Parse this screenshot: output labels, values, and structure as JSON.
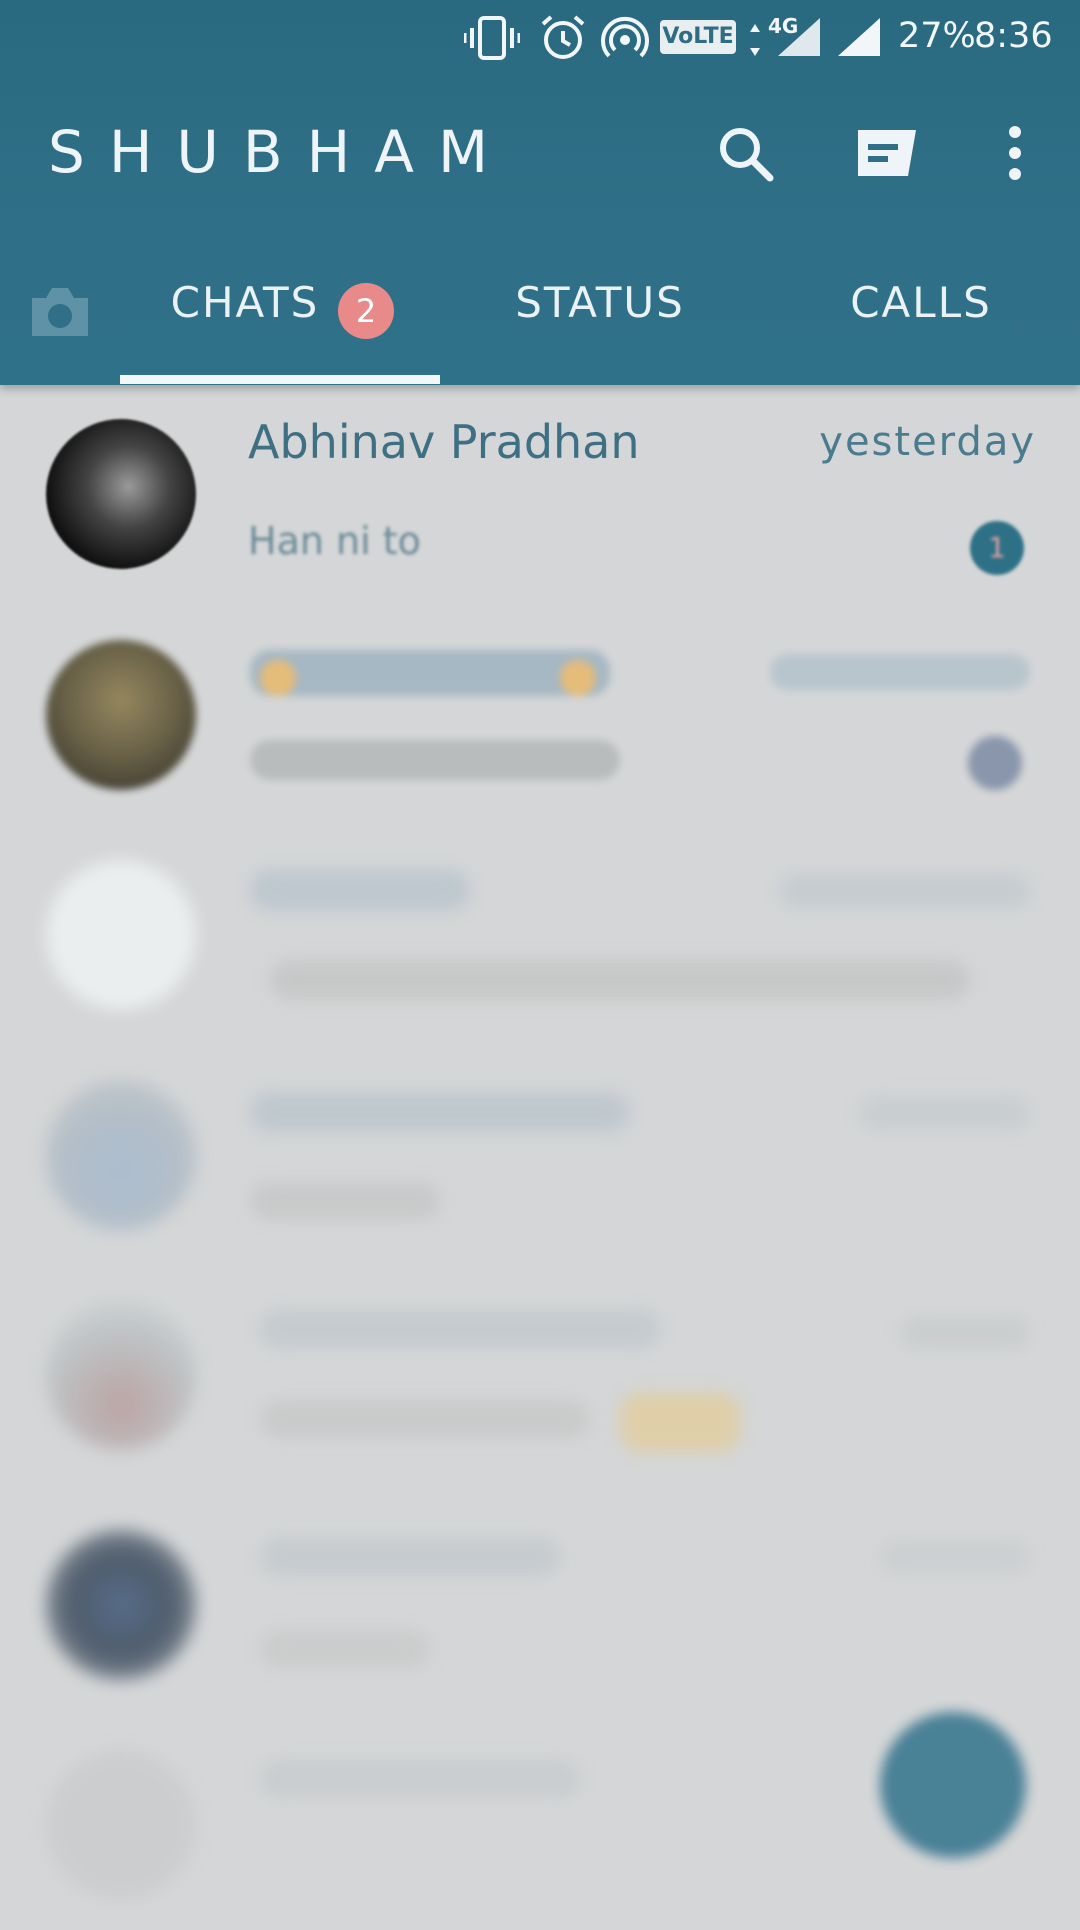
{
  "status_bar": {
    "icons": [
      "vibrate-icon",
      "alarm-icon",
      "hotspot-icon",
      "volte-badge",
      "network-4g-icon",
      "signal-icon"
    ],
    "volte_label": "VoLTE",
    "network_label": "4G",
    "battery": "27%",
    "time": "8:36"
  },
  "appbar": {
    "title": "SHUBHAM",
    "actions": [
      "search-icon",
      "new-chat-icon",
      "more-options-icon"
    ]
  },
  "tabs": {
    "camera_icon": "camera-icon",
    "items": [
      {
        "label": "CHATS",
        "badge": "2",
        "selected": true
      },
      {
        "label": "STATUS"
      },
      {
        "label": "CALLS"
      }
    ]
  },
  "chats": [
    {
      "name": "Abhinav Pradhan",
      "time": "yesterday",
      "preview": "Han ni to",
      "unread": "1"
    }
  ],
  "colors": {
    "primary": "#2f7088",
    "badge": "#e88a8a",
    "list_background": "#d4d6d7"
  }
}
